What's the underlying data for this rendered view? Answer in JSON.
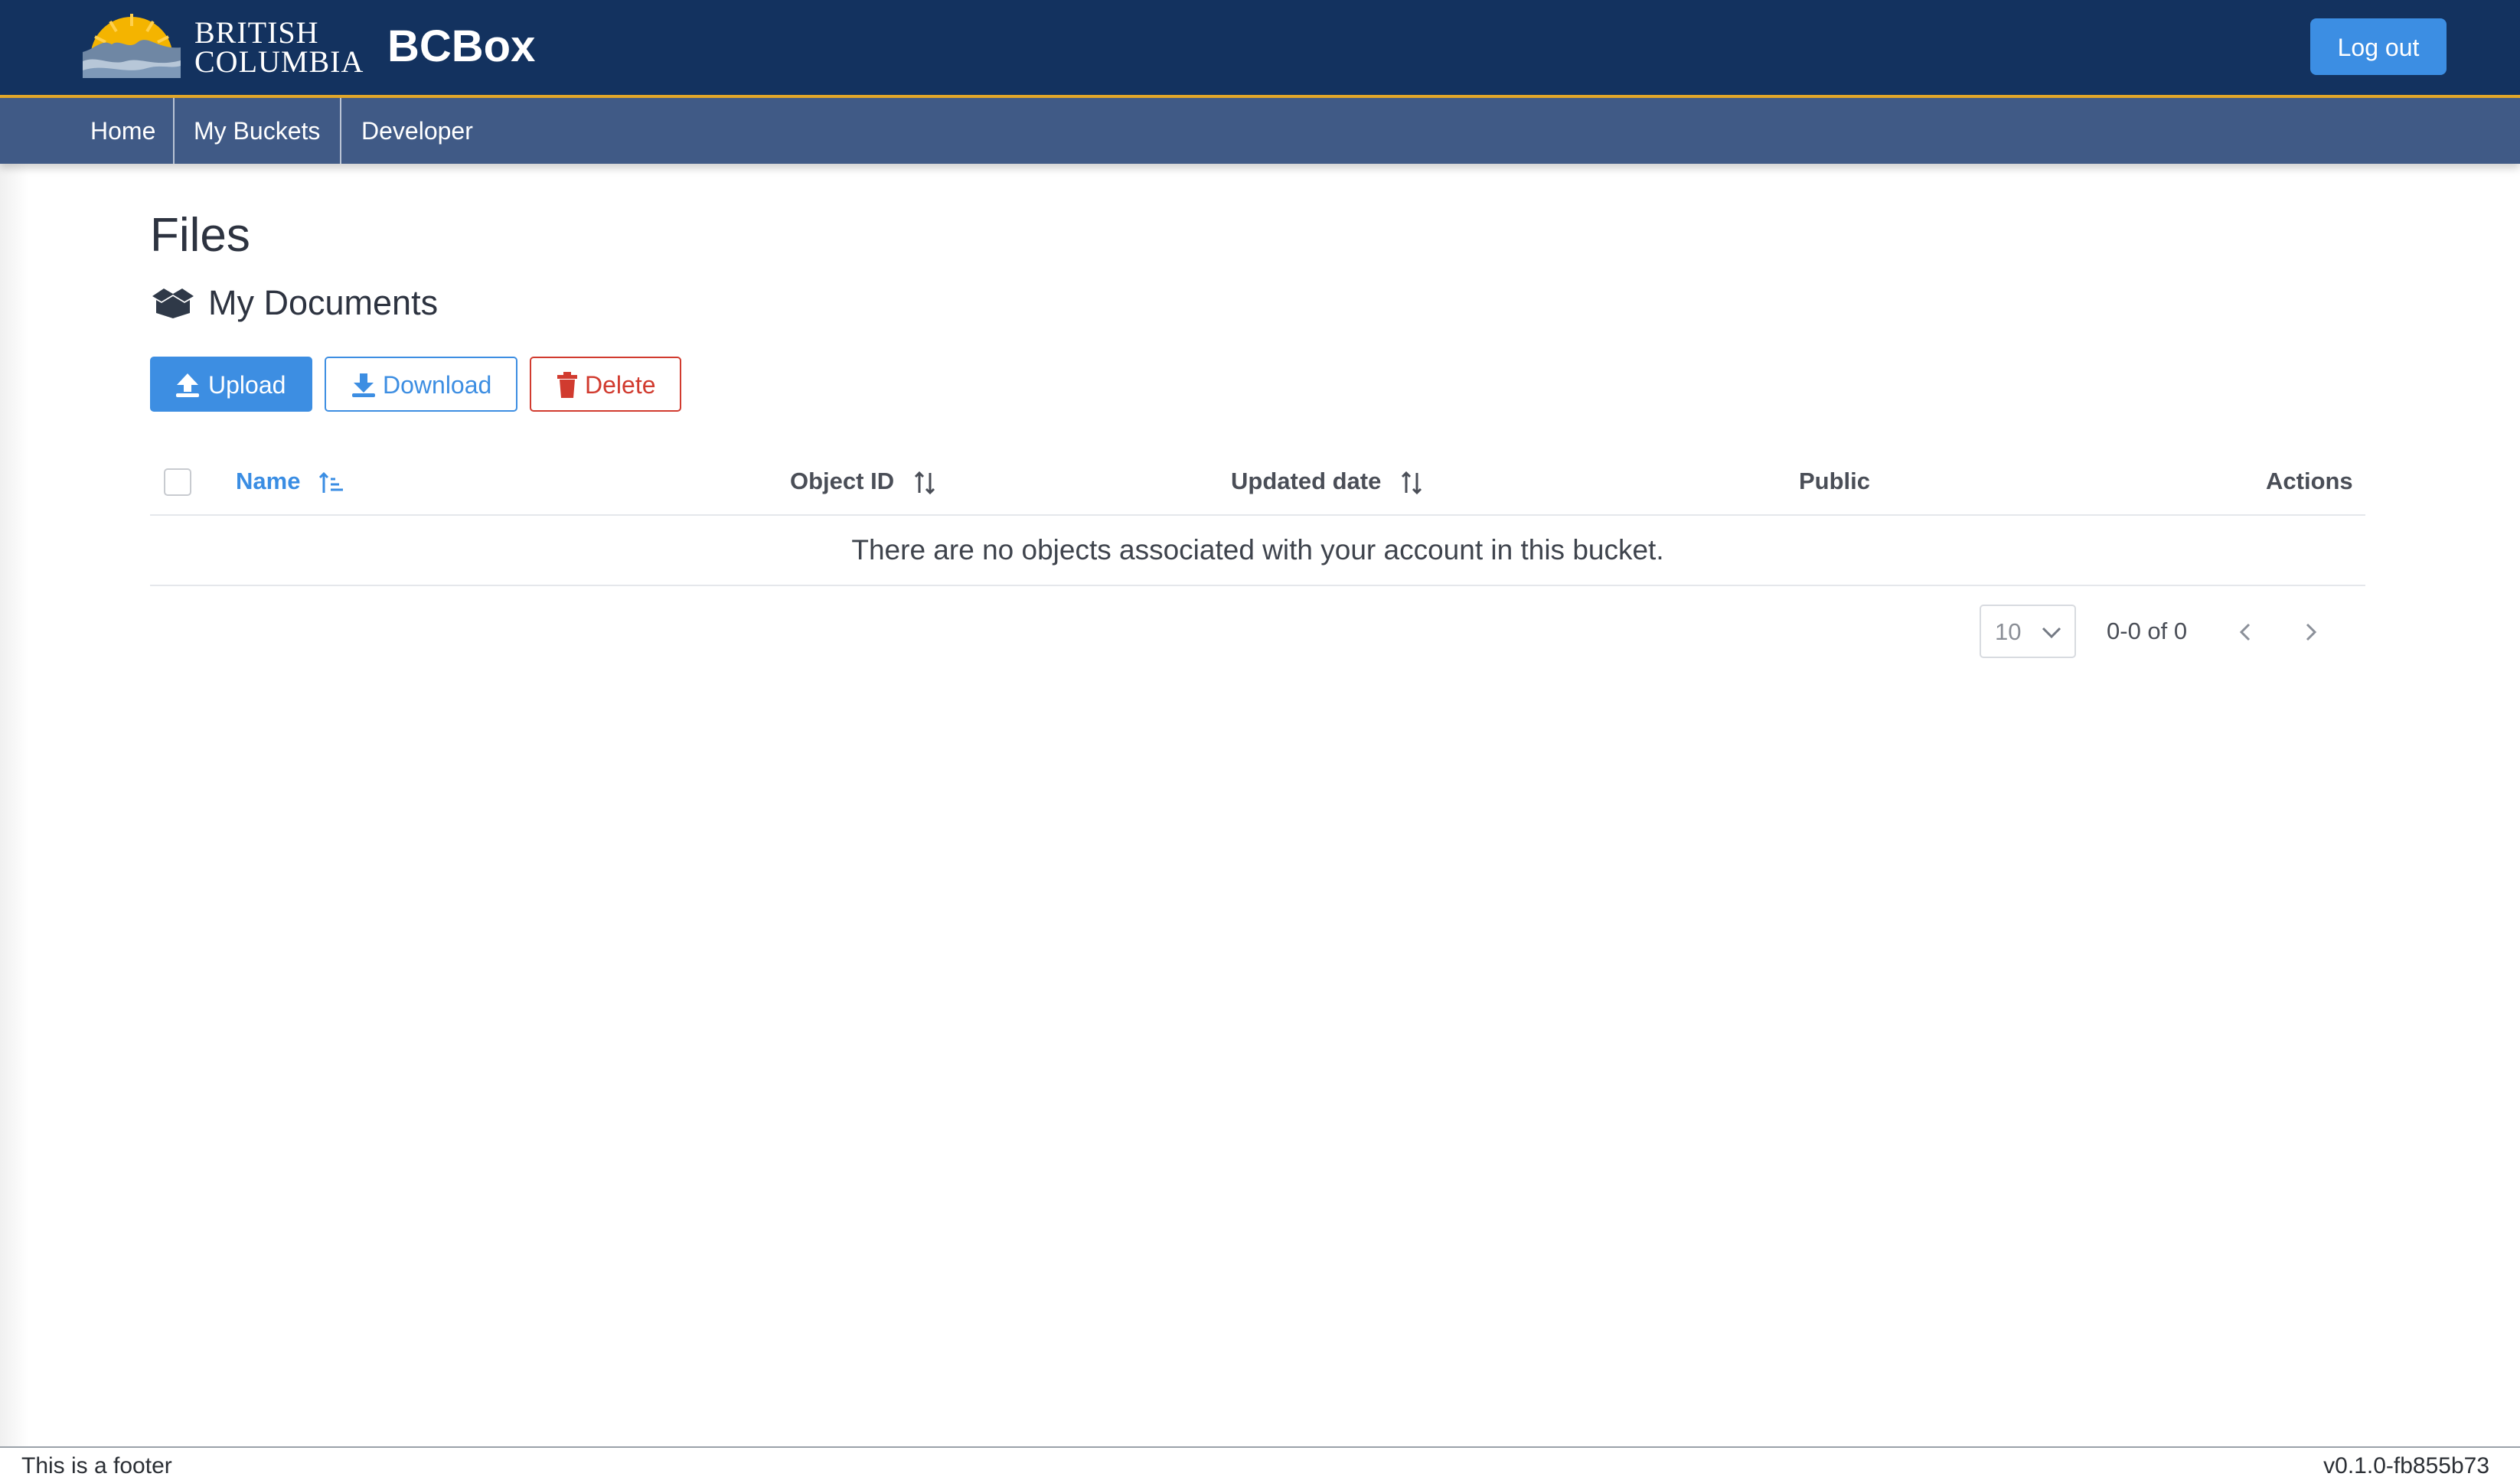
{
  "header": {
    "logo_line1": "BRITISH",
    "logo_line2": "COLUMBIA",
    "app_title": "BCBox",
    "logout_label": "Log out"
  },
  "nav": {
    "items": [
      {
        "label": "Home"
      },
      {
        "label": "My Buckets"
      },
      {
        "label": "Developer"
      }
    ]
  },
  "main": {
    "page_title": "Files",
    "bucket_name": "My Documents",
    "buttons": {
      "upload": "Upload",
      "download": "Download",
      "delete": "Delete"
    },
    "table": {
      "columns": [
        "Name",
        "Object ID",
        "Updated date",
        "Public",
        "Actions"
      ],
      "empty_message": "There are no objects associated with your account in this bucket."
    },
    "pagination": {
      "rows_per_page": "10",
      "range_text": "0-0 of 0"
    }
  },
  "footer": {
    "left_text": "This is a footer",
    "version": "v0.1.0-fb855b73"
  },
  "colors": {
    "header_bg": "#13325f",
    "nav_bg": "#405a86",
    "accent_gold": "#e3a82b",
    "primary_blue": "#3d8ee2",
    "danger_red": "#d13b2f"
  },
  "icons": {
    "logo": "bc-sunset-logo",
    "bucket": "box-open-icon",
    "upload": "upload-icon",
    "download": "download-icon",
    "delete": "trash-icon",
    "sort_name": "sort-ascending-icon",
    "sort_object_id": "sort-icon",
    "sort_updated": "sort-icon",
    "chevron_down": "chevron-down-icon",
    "prev": "chevron-left-icon",
    "next": "chevron-right-icon"
  }
}
